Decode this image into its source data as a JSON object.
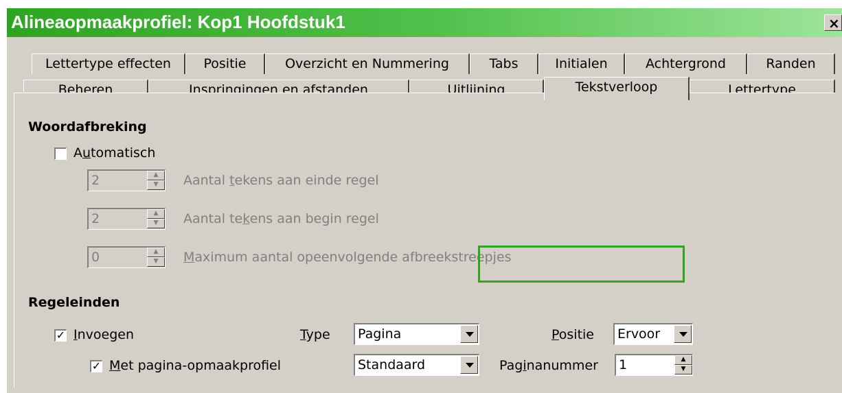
{
  "window": {
    "title": "Alineaopmaakprofiel: Kop1 Hoofdstuk1",
    "close_label": "×"
  },
  "tabs_back": [
    "Lettertype effecten",
    "Positie",
    "Overzicht en Nummering",
    "Tabs",
    "Initialen",
    "Achtergrond",
    "Randen"
  ],
  "tabs_front": [
    "Beheren",
    "Inspringingen en afstanden",
    "Uitlijning",
    "Tekstverloop",
    "Lettertype"
  ],
  "active_tab": "Tekstverloop",
  "hyphenation": {
    "heading": "Woordafbreking",
    "automatic": {
      "pre": "A",
      "ul": "u",
      "post": "tomatisch",
      "checked": false
    },
    "chars_end": {
      "value": "2",
      "pre": "Aantal ",
      "ul": "t",
      "post": "ekens aan einde regel"
    },
    "chars_begin": {
      "value": "2",
      "pre": "Aantal te",
      "ul": "k",
      "post": "ens aan begin regel"
    },
    "max_hyphens": {
      "value": "0",
      "pre": "",
      "ul": "M",
      "post": "aximum aantal opeenvolgende afbreekstreepjes"
    }
  },
  "breaks": {
    "heading": "Regeleinden",
    "insert": {
      "pre": "",
      "ul": "I",
      "post": "nvoegen",
      "checked": true,
      "check_mark": "✓"
    },
    "type": {
      "label_ul": "T",
      "label_post": "ype",
      "value": "Pagina"
    },
    "position": {
      "label_ul": "P",
      "label_post": "ositie",
      "value": "Ervoor"
    },
    "with_page_style": {
      "pre": "",
      "ul": "M",
      "post": "et pagina-opmaakprofiel",
      "checked": true,
      "check_mark": "✓"
    },
    "page_style": {
      "value": "Standaard"
    },
    "page_number": {
      "label_pre": "Pag",
      "label_ul": "i",
      "label_post": "nanummer",
      "value": "1"
    }
  },
  "colors": {
    "title_green": "#2ea421",
    "dialog_bg": "#d4d0c8"
  }
}
